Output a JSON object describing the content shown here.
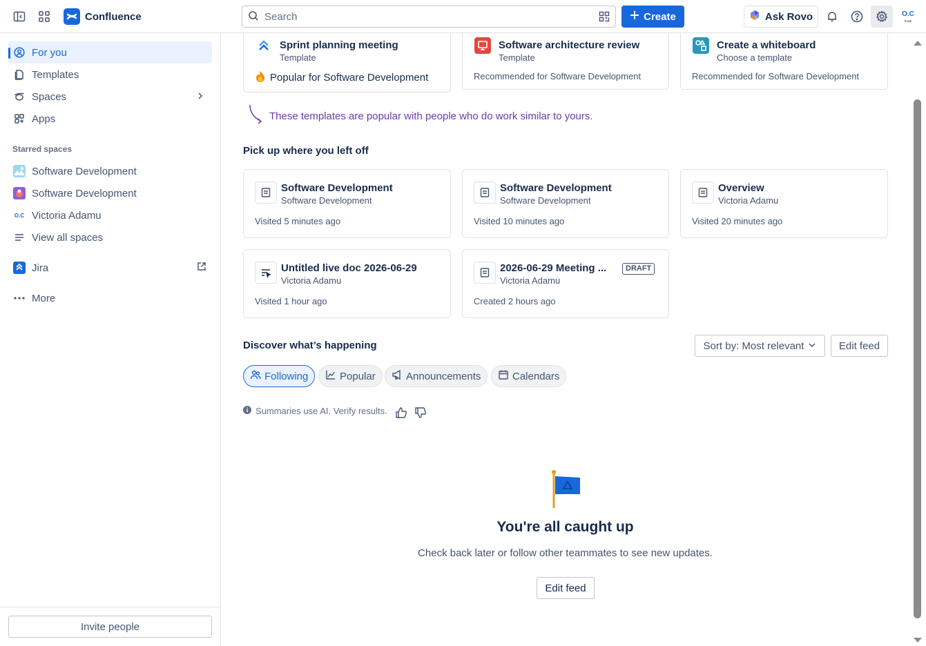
{
  "topbar": {
    "app_name": "Confluence",
    "search_placeholder": "Search",
    "create_label": "Create",
    "ask_rovo_label": "Ask Rovo",
    "avatar_initials_top": "O.C",
    "avatar_initials_bottom": "FUSE"
  },
  "sidebar": {
    "items": [
      {
        "label": "For you",
        "icon": "user-circle-icon",
        "active": true
      },
      {
        "label": "Templates",
        "icon": "template-icon"
      },
      {
        "label": "Spaces",
        "icon": "spaces-icon"
      },
      {
        "label": "Apps",
        "icon": "apps-icon"
      }
    ],
    "starred_header": "Starred spaces",
    "starred": [
      {
        "label": "Software Development",
        "icon": "space-avatar-mountain-icon"
      },
      {
        "label": "Software Development",
        "icon": "space-avatar-purple-icon"
      },
      {
        "label": "Victoria Adamu",
        "icon": "personal-space-icon"
      }
    ],
    "view_all": "View all spaces",
    "jira": "Jira",
    "more": "More",
    "invite": "Invite people"
  },
  "templates": [
    {
      "title": "Sprint planning meeting",
      "subtitle": "Template",
      "footer": "Popular for Software Development",
      "icon": "jira-sprint-icon"
    },
    {
      "title": "Software architecture review",
      "subtitle": "Template",
      "footer": "Recommended for Software Development",
      "icon": "architecture-review-icon"
    },
    {
      "title": "Create a whiteboard",
      "subtitle": "Choose a template",
      "footer": "Recommended for Software Development",
      "icon": "whiteboard-icon"
    }
  ],
  "template_hint": "These templates are popular with people who do work similar to yours.",
  "recent": {
    "title": "Pick up where you left off",
    "items": [
      {
        "title": "Software Development",
        "subtitle": "Software Development",
        "footer": "Visited 5 minutes ago",
        "icon": "page-icon"
      },
      {
        "title": "Software Development",
        "subtitle": "Software Development",
        "footer": "Visited 10 minutes ago",
        "icon": "page-icon"
      },
      {
        "title": "Overview",
        "subtitle": "Victoria Adamu",
        "footer": "Visited 20 minutes ago",
        "icon": "page-icon"
      },
      {
        "title": "Untitled live doc 2026-06-29",
        "subtitle": "Victoria Adamu",
        "footer": "Visited 1 hour ago",
        "icon": "live-doc-icon"
      },
      {
        "title": "2026-06-29 Meeting ...",
        "subtitle": "Victoria Adamu",
        "footer": "Created 2 hours ago",
        "badge": "DRAFT",
        "icon": "page-icon"
      }
    ]
  },
  "discover": {
    "title": "Discover what’s happening",
    "sort_label": "Sort by: Most relevant",
    "edit_feed": "Edit feed",
    "tabs": [
      {
        "label": "Following",
        "selected": true
      },
      {
        "label": "Popular"
      },
      {
        "label": "Announcements"
      },
      {
        "label": "Calendars"
      }
    ],
    "ai_note": "Summaries use AI. Verify results.",
    "empty_title": "You're all caught up",
    "empty_sub": "Check back later or follow other teammates to see new updates.",
    "empty_button": "Edit feed"
  },
  "colors": {
    "brand": "#1868db",
    "hint_purple": "#6e3ba8"
  }
}
